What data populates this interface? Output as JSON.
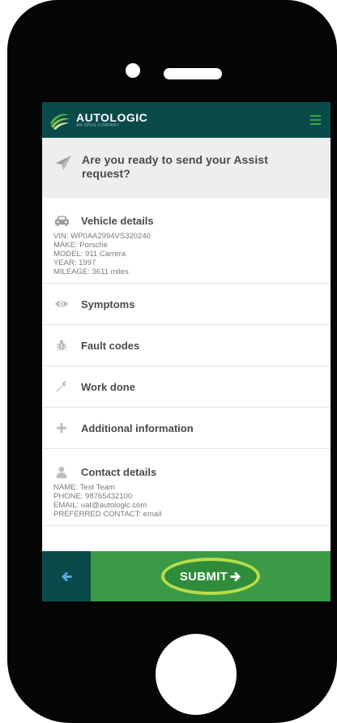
{
  "app": {
    "brand_name": "AUTOLOGIC",
    "brand_sub": "AN OPUS COMPANY",
    "colors": {
      "header_bg": "#0b4a4a",
      "accent_green": "#3b9a46",
      "highlight_ring": "#b8dc4a"
    }
  },
  "prompt": {
    "icon": "paper-plane-icon",
    "text": "Are you ready to send your Assist request?"
  },
  "vehicle": {
    "icon": "car-icon",
    "title": "Vehicle details",
    "lines": [
      "VIN: WP0AA2994VS320240",
      "MAKE: Porsche",
      "MODEL: 911 Carrera",
      "YEAR: 1997",
      "MILEAGE: 3611 miles"
    ]
  },
  "sections": [
    {
      "icon": "eye-icon",
      "title": "Symptoms"
    },
    {
      "icon": "bug-icon",
      "title": "Fault codes"
    },
    {
      "icon": "wrench-icon",
      "title": "Work done"
    },
    {
      "icon": "plus-icon",
      "title": "Additional information"
    }
  ],
  "contact": {
    "icon": "user-icon",
    "title": "Contact details",
    "lines": [
      "NAME: Test Team",
      "PHONE: 98765432100",
      "EMAIL: uat@autologic.com",
      "PREFERRED CONTACT: email"
    ]
  },
  "footer": {
    "back_icon": "arrow-left-icon",
    "submit_label": "SUBMIT",
    "submit_icon": "arrow-right-icon"
  }
}
